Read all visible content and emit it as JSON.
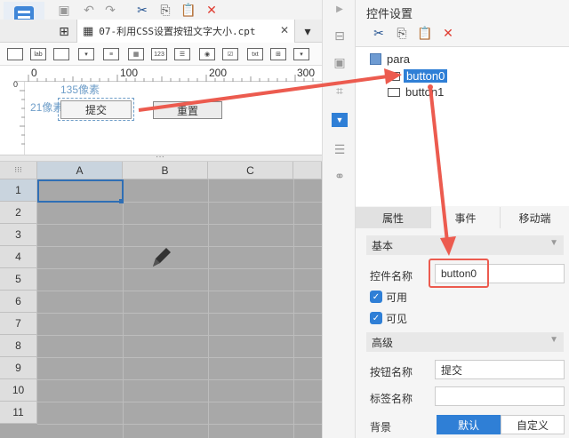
{
  "editor": {
    "tab_filename": "07-利用CSS设置按钮文字大小.cpt",
    "ruler_ticks": [
      "0",
      "100",
      "200",
      "300"
    ],
    "ruler_left": "0",
    "widget_icons": [
      "lab",
      "123",
      "txt"
    ]
  },
  "design": {
    "annot_35": "135像素",
    "annot_21": "21像素",
    "button_submit": "提交",
    "button_reset": "重置"
  },
  "grid": {
    "columns": [
      "A",
      "B",
      "C"
    ],
    "rows": [
      "1",
      "2",
      "3",
      "4",
      "5",
      "6",
      "7",
      "8",
      "9",
      "10",
      "11"
    ]
  },
  "panel": {
    "title": "控件设置",
    "tree": [
      "para",
      "button0",
      "button1"
    ],
    "tabs": [
      "属性",
      "事件",
      "移动端"
    ],
    "basic_section": "基本",
    "name_label": "控件名称",
    "name_value": "button0",
    "enabled_label": "可用",
    "visible_label": "可见",
    "advanced_section": "高级",
    "btn_name_label": "按钮名称",
    "btn_name_value": "提交",
    "tag_name_label": "标签名称",
    "tag_name_value": "",
    "bg_label": "背景",
    "bg_default": "默认",
    "bg_custom": "自定义"
  },
  "colors": {
    "accent": "#2f7fd6",
    "annotation": "#ec5b4f",
    "selected_tree": "#2f7fd6"
  }
}
